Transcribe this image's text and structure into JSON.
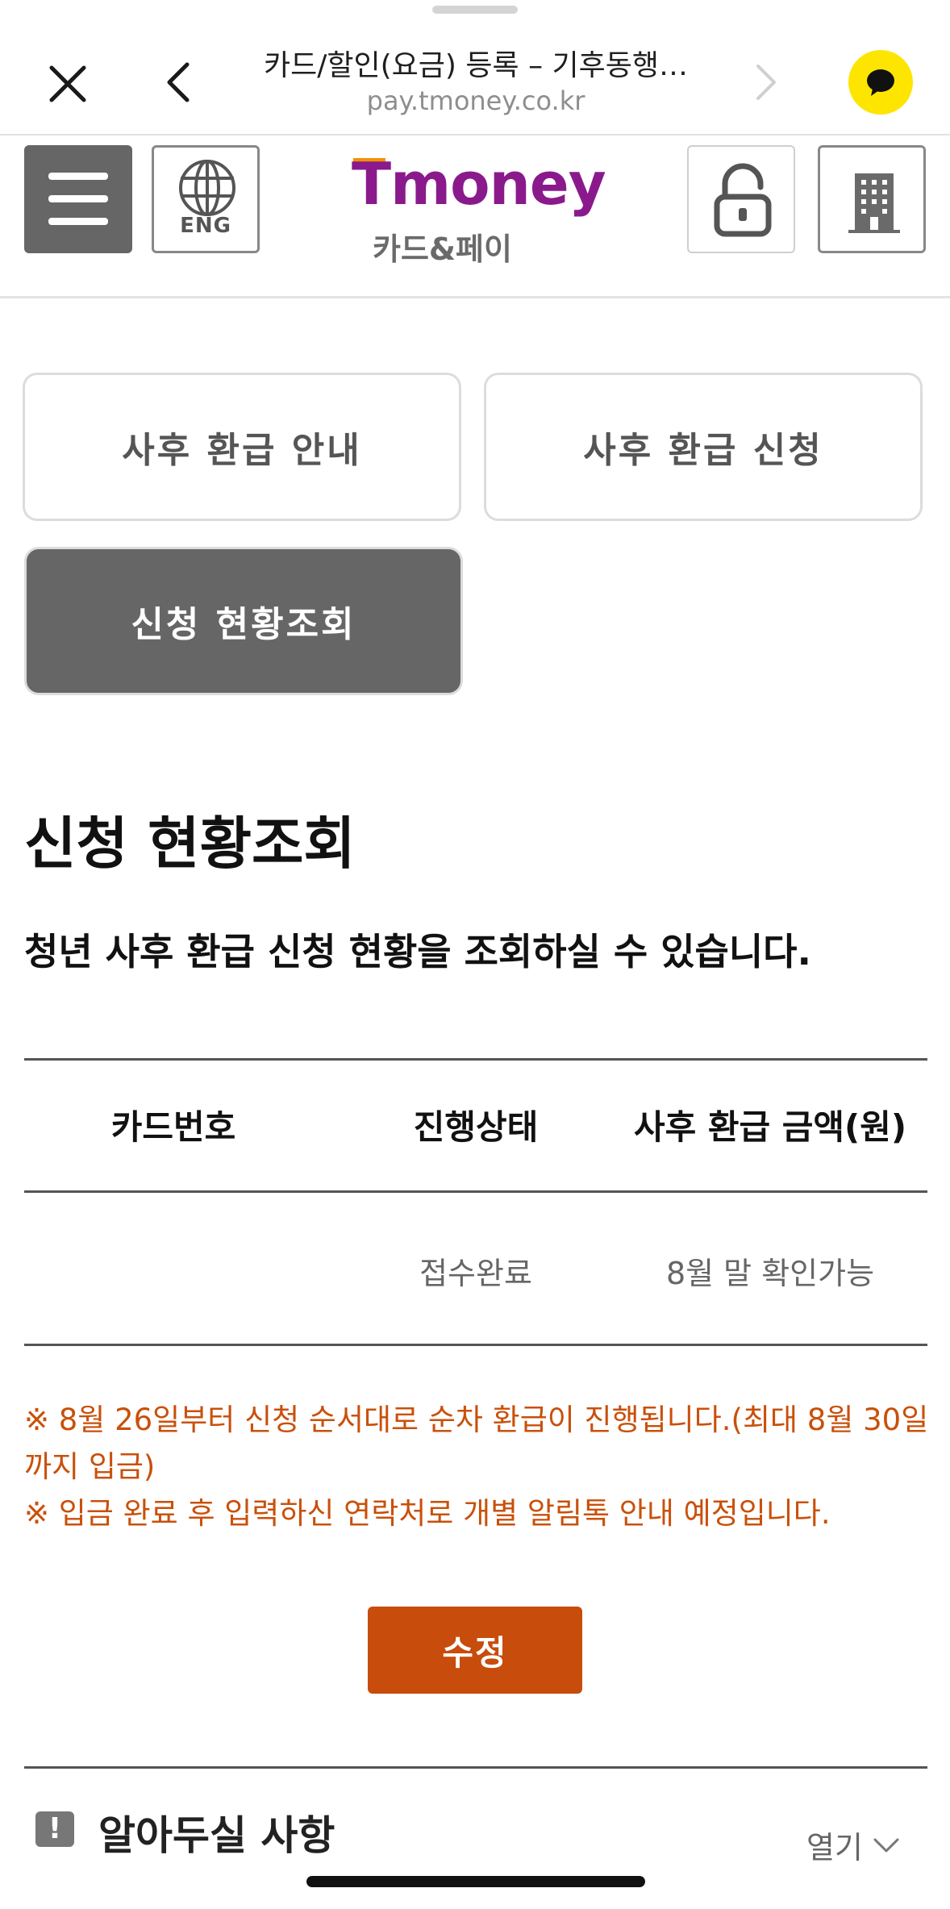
{
  "browser": {
    "title": "카드/할인(요금) 등록 – 기후동행…",
    "url": "pay.tmoney.co.kr"
  },
  "header": {
    "eng_label": "ENG",
    "logo_word": "Tmoney",
    "logo_sub": "카드&페이"
  },
  "tabs": {
    "guide": "사후 환급 안내",
    "apply": "사후 환급 신청",
    "status": "신청 현황조회"
  },
  "main": {
    "title": "신청 현황조회",
    "description": "청년 사후 환급 신청 현황을 조회하실 수 있습니다."
  },
  "table": {
    "headers": [
      "카드번호",
      "진행상태",
      "사후 환급 금액(원)"
    ],
    "rows": [
      {
        "card_number": "",
        "status": "접수완료",
        "amount": "8월 말 확인가능"
      }
    ]
  },
  "notices": [
    "※ 8월 26일부터 신청 순서대로 순차 환급이 진행됩니다.(최대 8월 30일까지 입금)",
    "※ 입금 완료 후 입력하신 연락처로 개별 알림톡 안내 예정입니다."
  ],
  "edit_button": "수정",
  "info_section": {
    "icon": "!",
    "title": "알아두실 사항",
    "toggle": "열기"
  },
  "colors": {
    "brand": "#8a1a8c",
    "accent": "#c84c0c",
    "active_tab": "#666666",
    "kakao": "#fee500"
  }
}
